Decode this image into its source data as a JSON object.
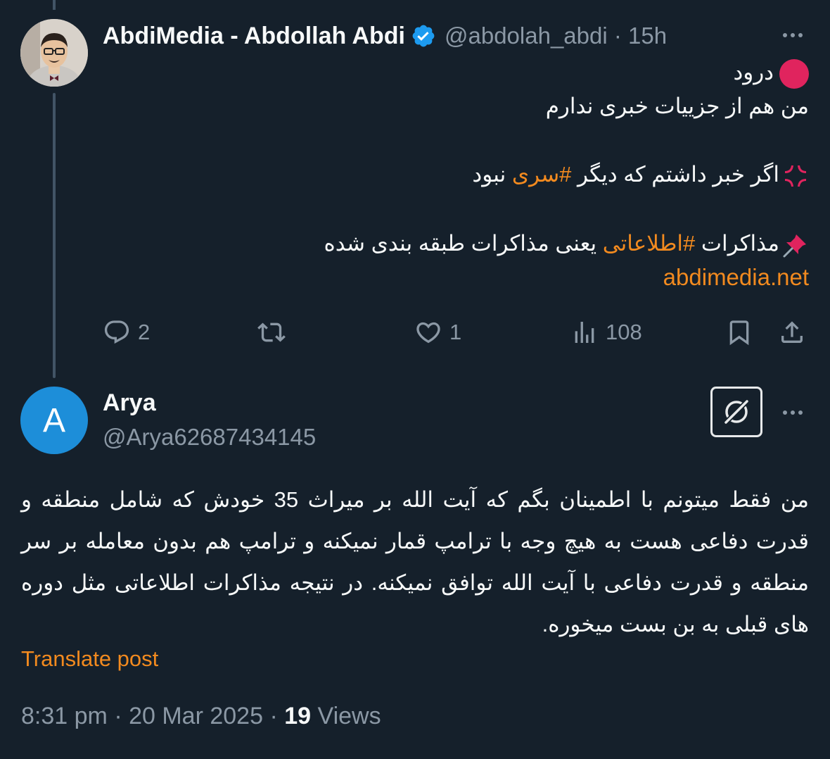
{
  "post": {
    "author_name": "AbdiMedia - Abdollah Abdi",
    "handle": "@abdolah_abdi",
    "separator": "·",
    "time": "15h",
    "lines": {
      "greeting": "درود",
      "line2": "من هم از جزییات خبری ندارم",
      "line3_pre": "اگر خبر داشتم که دیگر ",
      "line3_tag": "#سری",
      "line3_post": " نبود",
      "line4_pre": "مذاکرات ",
      "line4_tag": "#اطلاعاتی",
      "line4_post": " یعنی مذاکرات طبقه بندی شده",
      "link": "abdimedia.net"
    },
    "actions": {
      "replies": "2",
      "reposts": "",
      "likes": "1",
      "views": "108"
    }
  },
  "reply": {
    "avatar_letter": "A",
    "author_name": "Arya",
    "handle": "@Arya62687434145",
    "text": "من فقط میتونم با اطمینان بگم که آیت الله بر میراث 35 خودش که شامل منطقه و قدرت دفاعی هست به هیچ وجه با ترامپ قمار نمیکنه و ترامپ هم بدون معامله بر سر منطقه و قدرت دفاعی با آیت الله توافق نمیکنه. در نتیجه مذاکرات اطلاعاتی مثل دوره های قبلی به بن بست میخوره.",
    "translate_label": "Translate post",
    "meta": {
      "time": "8:31 pm",
      "date": "20 Mar 2025",
      "views_count": "19",
      "views_label": "Views"
    }
  },
  "colors": {
    "background": "#15202b",
    "accent": "#f28a1f",
    "muted": "#8b98a5",
    "verified": "#1d9bf0",
    "avatar_reply": "#1d8ed9"
  },
  "icons": {
    "verified": "verified-badge-icon",
    "more": "more-horizontal-icon",
    "reply": "reply-bubble-icon",
    "repost": "repost-icon",
    "like": "heart-icon",
    "views": "views-bar-chart-icon",
    "bookmark": "bookmark-icon",
    "share": "share-icon",
    "grok": "grok-icon"
  }
}
